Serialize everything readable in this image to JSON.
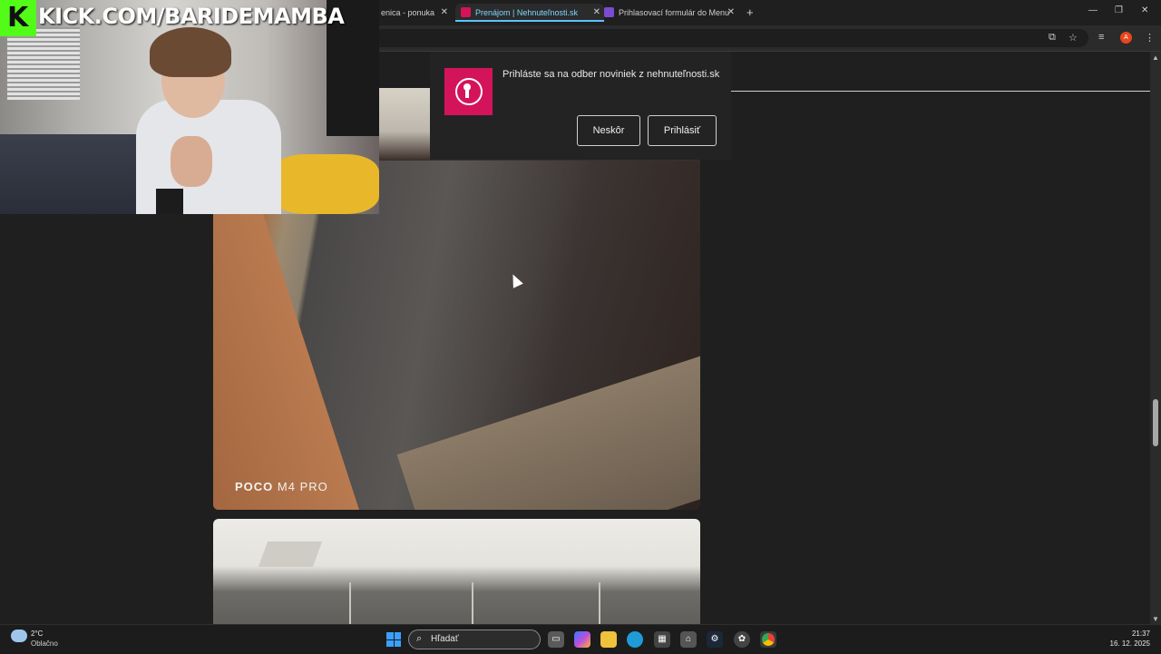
{
  "browser": {
    "tabs": [
      {
        "label": "enica - ponuka",
        "active": false,
        "favicon_color": "#1f1f1f"
      },
      {
        "label": "Prenájom | Nehnuteľnosti.sk",
        "active": true,
        "favicon_color": "#d4145a"
      },
      {
        "label": "Prihlasovací formulár do Menu",
        "active": false,
        "favicon_color": "#7b4ccf"
      }
    ],
    "new_tab_glyph": "+",
    "close_glyph": "✕",
    "window_controls": {
      "minimize": "—",
      "restore": "❐",
      "close": "✕"
    },
    "toolbar_icons": [
      "install-app-icon",
      "bookmark-star-icon",
      "media-control-icon",
      "profile-avatar",
      "menu-kebab-icon"
    ],
    "avatar_letter": "A"
  },
  "notification": {
    "message": "Prihláste sa na odber noviniek z nehnuteľnosti.sk",
    "later_label": "Neskôr",
    "subscribe_label": "Prihlásiť",
    "logo_icon": "keyhole-icon",
    "brand_color": "#d4145a"
  },
  "gallery": {
    "photo1_caption_brand": "POCO",
    "photo1_caption_model": "M4 PRO"
  },
  "stream_overlay": {
    "logo_letter": "K",
    "channel_text": "KICK.COM/BARIDEMAMBA",
    "brand_color": "#53fc18"
  },
  "taskbar": {
    "weather_temp": "2°C",
    "weather_desc": "Oblačno",
    "search_placeholder": "Hľadať",
    "time": "21:37",
    "date": "16. 12. 2025",
    "apps": [
      "task-view-icon",
      "copilot-icon",
      "file-explorer-icon",
      "edge-icon",
      "store-icon",
      "outlook-icon",
      "steam-icon",
      "settings-icon",
      "chrome-icon"
    ]
  }
}
